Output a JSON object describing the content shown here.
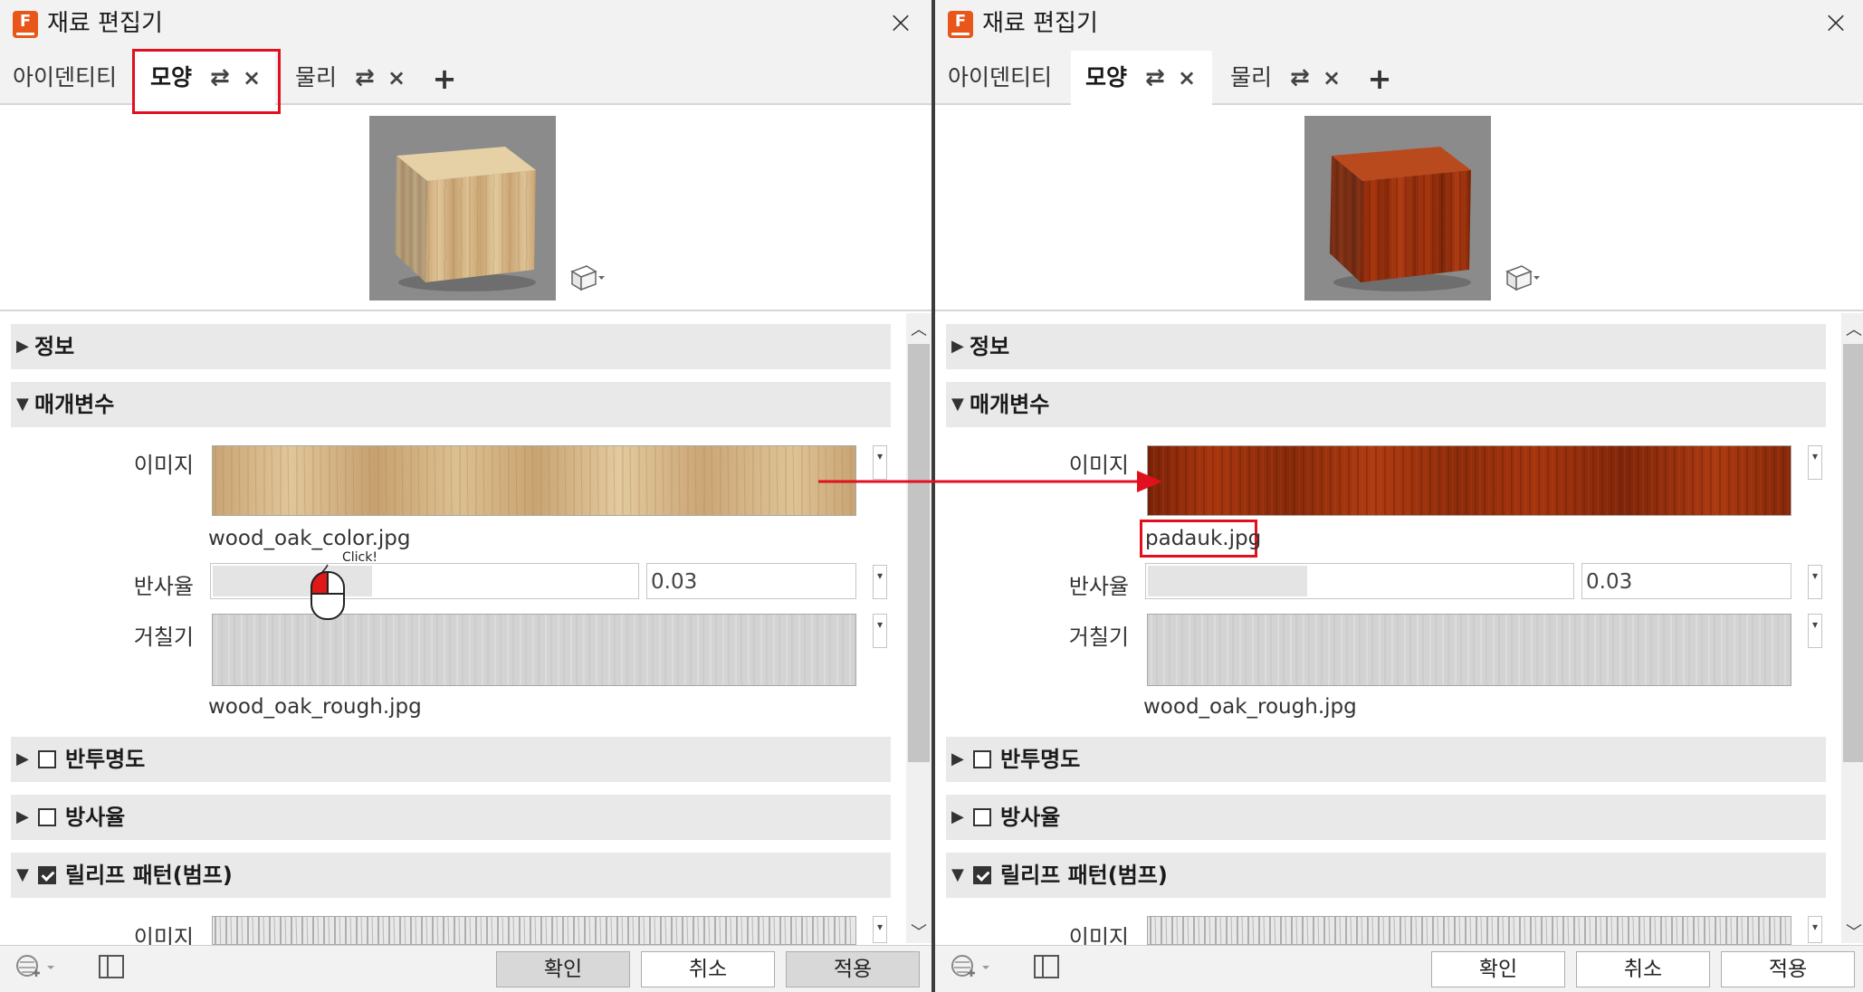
{
  "panels": [
    {
      "title": "재료 편집기",
      "app_icon_letter": "F",
      "tabs": [
        {
          "label": "아이덴티티"
        },
        {
          "label": "모양",
          "swap": "⇄",
          "close": "×"
        },
        {
          "label": "물리",
          "swap": "⇄",
          "close": "×"
        }
      ],
      "add_tab": "+",
      "sections": {
        "info": "정보",
        "params": "매개변수",
        "transparency": "반투명도",
        "emission": "방사율",
        "bump": "릴리프 패턴(범프)"
      },
      "params": {
        "image_label": "이미지",
        "image_file": "wood_oak_color.jpg",
        "reflectance_label": "반사율",
        "reflectance_value": "0.03",
        "roughness_label": "거칠기",
        "roughness_file": "wood_oak_rough.jpg",
        "bump_image_label": "이미지"
      },
      "buttons": {
        "ok": "확인",
        "cancel": "취소",
        "apply": "적용"
      },
      "click_annotation": "Click!"
    },
    {
      "title": "재료 편집기",
      "app_icon_letter": "F",
      "tabs": [
        {
          "label": "아이덴티티"
        },
        {
          "label": "모양",
          "swap": "⇄",
          "close": "×"
        },
        {
          "label": "물리",
          "swap": "⇄",
          "close": "×"
        }
      ],
      "add_tab": "+",
      "sections": {
        "info": "정보",
        "params": "매개변수",
        "transparency": "반투명도",
        "emission": "방사율",
        "bump": "릴리프 패턴(범프)"
      },
      "params": {
        "image_label": "이미지",
        "image_file": "padauk.jpg",
        "reflectance_label": "반사율",
        "reflectance_value": "0.03",
        "roughness_label": "거칠기",
        "roughness_file": "wood_oak_rough.jpg",
        "bump_image_label": "이미지"
      },
      "buttons": {
        "ok": "확인",
        "cancel": "취소",
        "apply": "적용"
      }
    }
  ],
  "colors": {
    "highlight": "#e0101e",
    "oak": "#d2b48c",
    "padauk": "#8b2a0c",
    "brand": "#e8561a"
  },
  "icons": [
    "app-icon",
    "close-icon",
    "swap-icon",
    "tab-close-icon",
    "add-tab-icon",
    "cube-view-icon",
    "expand-triangle-icon",
    "checkbox-icon",
    "dropdown-icon",
    "render-settings-icon",
    "layout-panel-icon",
    "mouse-click-icon",
    "scroll-up-icon",
    "scroll-down-icon"
  ]
}
